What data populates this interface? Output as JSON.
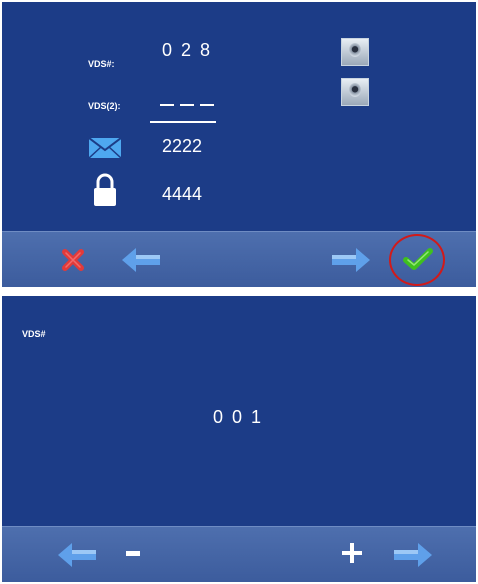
{
  "top_screen": {
    "vds_label": "VDS#:",
    "vds_value": "0 2 8",
    "vds2_label": "VDS(2):",
    "mail_value": "2222",
    "lock_value": "4444",
    "icons": [
      "camera-icon",
      "camera-icon",
      "mail-icon",
      "lock-icon"
    ],
    "bar": {
      "buttons": [
        "cancel-icon",
        "arrow-left-icon",
        "arrow-right-icon",
        "confirm-check-icon"
      ]
    },
    "highlight_color": "#d11a1a"
  },
  "bottom_screen": {
    "title": "VDS#",
    "value": "0 0 1",
    "bar": {
      "minus_label": "−",
      "plus_label": "+",
      "buttons": [
        "arrow-left-icon",
        "minus-button",
        "plus-button",
        "arrow-right-icon"
      ]
    }
  },
  "colors": {
    "screen_bg": "#1c3c87",
    "bar_bg": "#4a6aab",
    "text": "#ffffff",
    "arrow": "#5fa0ea",
    "check": "#3fc01e",
    "cancel": "#e23a3a"
  }
}
